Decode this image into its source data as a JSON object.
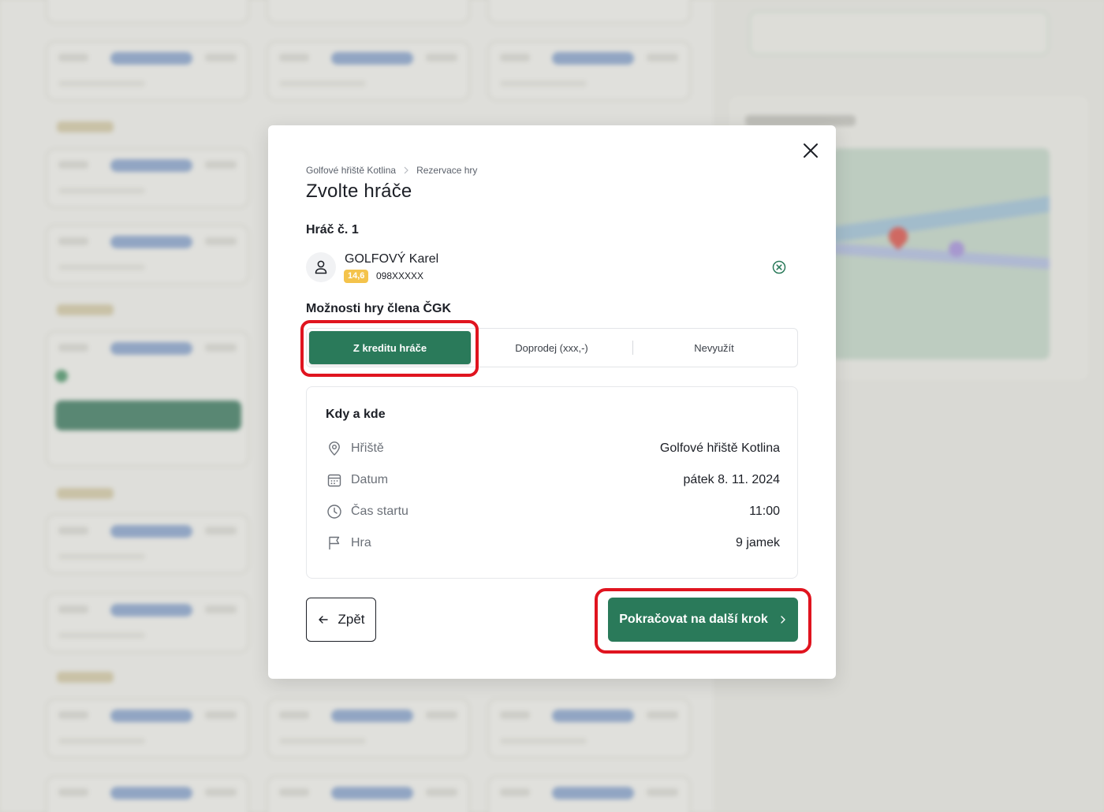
{
  "modal": {
    "breadcrumb": [
      "Golfové hřiště Kotlina",
      "Rezervace hry"
    ],
    "title": "Zvolte hráče",
    "player_heading": "Hráč č. 1",
    "player": {
      "name": "GOLFOVÝ Karel",
      "handicap": "14,6",
      "member_id": "098XXXXX"
    },
    "options_heading": "Možnosti hry člena ČGK",
    "options": [
      {
        "label": "Z kreditu hráče",
        "selected": true
      },
      {
        "label": "Doprodej (xxx,-)",
        "selected": false
      },
      {
        "label": "Nevyužít",
        "selected": false
      }
    ],
    "info_card": {
      "title": "Kdy a kde",
      "rows": [
        {
          "icon": "map-pin-icon",
          "label": "Hřiště",
          "value": "Golfové hřiště Kotlina"
        },
        {
          "icon": "calendar-icon",
          "label": "Datum",
          "value": "pátek 8. 11. 2024"
        },
        {
          "icon": "clock-icon",
          "label": "Čas startu",
          "value": "11:00"
        },
        {
          "icon": "flag-icon",
          "label": "Hra",
          "value": "9 jamek"
        }
      ]
    },
    "back_label": "Zpět",
    "next_label": "Pokračovat na další krok"
  },
  "colors": {
    "accent": "#2a7a5a",
    "badge": "#f4c34b",
    "highlight": "#e0141f"
  }
}
